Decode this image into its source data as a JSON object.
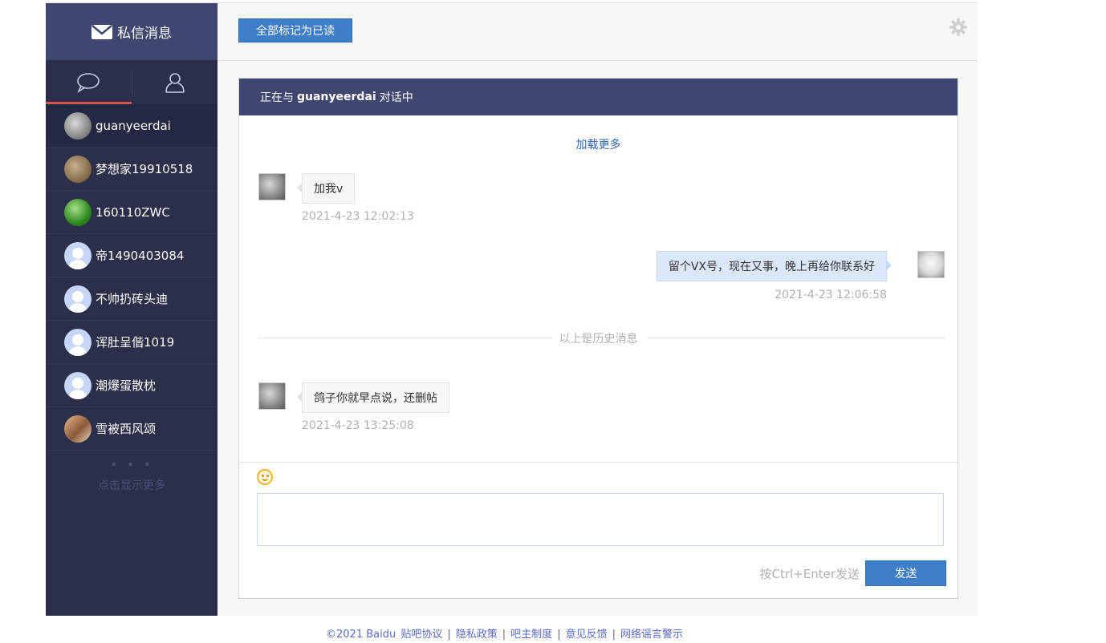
{
  "sidebar": {
    "title": "私信消息",
    "contacts": [
      {
        "name": "guanyeerdai",
        "avatar": "coin"
      },
      {
        "name": "梦想家19910518",
        "avatar": "coin2"
      },
      {
        "name": "160110ZWC",
        "avatar": "green"
      },
      {
        "name": "帝1490403084",
        "avatar": "default"
      },
      {
        "name": "不帅扔砖头迪",
        "avatar": "default"
      },
      {
        "name": "诨肚呈偕1019",
        "avatar": "default"
      },
      {
        "name": "潮爆蛋散枕",
        "avatar": "default"
      },
      {
        "name": "雪被西风颂",
        "avatar": "photo"
      }
    ],
    "more_dots": "• • •",
    "show_more": "点击显示更多"
  },
  "topbar": {
    "mark_all_read": "全部标记为已读"
  },
  "chat": {
    "header_prefix": "正在与",
    "partner": "guanyeerdai",
    "header_suffix": "对话中",
    "load_more": "加载更多",
    "messages": [
      {
        "side": "left",
        "text": "加我v",
        "time": "2021-4-23 12:02:13"
      },
      {
        "side": "right",
        "text": "留个VX号，现在又事，晚上再给你联系好",
        "time": "2021-4-23 12:06:58"
      },
      {
        "side": "left",
        "text": "鸽子你就早点说，还删帖",
        "time": "2021-4-23 13:25:08"
      }
    ],
    "history_divider": "以上是历史消息"
  },
  "composer": {
    "input_value": "",
    "hint": "按Ctrl+Enter发送",
    "send_label": "发送"
  },
  "footer": {
    "copyright": "©2021 Baidu",
    "links": [
      "贴吧协议",
      "隐私政策",
      "吧主制度",
      "意见反馈",
      "网络谣言警示"
    ]
  },
  "colors": {
    "sidebar_bg": "#2b2f4a",
    "header_bg": "#3f4770",
    "accent_blue": "#3f7ec8",
    "active_tab": "#d9534f"
  }
}
